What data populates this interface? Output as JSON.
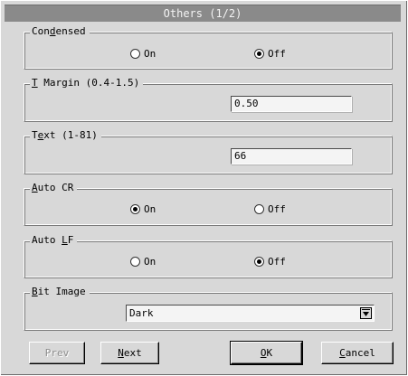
{
  "window": {
    "title": "Others (1/2)"
  },
  "condensed": {
    "label_underline": "d",
    "label_pre": "Con",
    "label_post": "ensed",
    "options": [
      {
        "label": "On",
        "selected": false
      },
      {
        "label": "Off",
        "selected": true
      }
    ]
  },
  "t_margin": {
    "label_underline": "T",
    "label_post": " Margin (0.4-1.5)",
    "value": "0.50"
  },
  "text": {
    "label_pre": "T",
    "label_underline": "e",
    "label_post": "xt (1-81)",
    "value": "66"
  },
  "auto_cr": {
    "label_underline": "A",
    "label_post": "uto CR",
    "options": [
      {
        "label": "On",
        "selected": true
      },
      {
        "label": "Off",
        "selected": false
      }
    ]
  },
  "auto_lf": {
    "label_pre": "Auto ",
    "label_underline": "L",
    "label_post": "F",
    "options": [
      {
        "label": "On",
        "selected": false
      },
      {
        "label": "Off",
        "selected": true
      }
    ]
  },
  "bit_image": {
    "label_underline": "B",
    "label_post": "it Image",
    "value": "Dark"
  },
  "buttons": {
    "prev": {
      "label": "Prev",
      "enabled": false
    },
    "next": {
      "label_underline": "N",
      "label_post": "ext"
    },
    "ok": {
      "label_underline": "O",
      "label_post": "K"
    },
    "cancel": {
      "label_underline": "C",
      "label_post": "ancel"
    }
  },
  "icons": {
    "radio": "radio-button",
    "dropdown": "dropdown-arrow-icon"
  }
}
